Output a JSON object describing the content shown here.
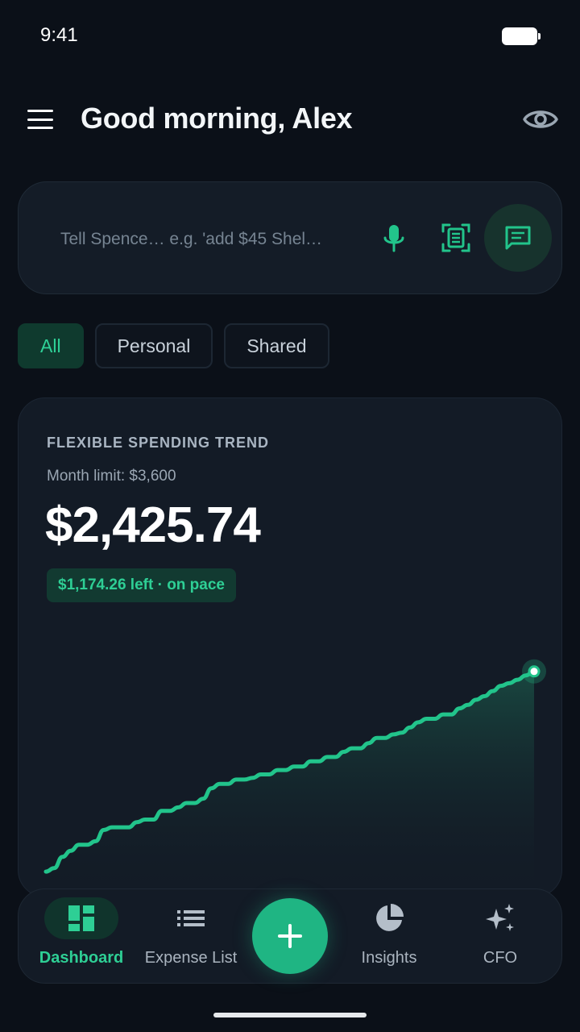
{
  "status_bar": {
    "time": "9:41"
  },
  "header": {
    "greeting": "Good morning, Alex"
  },
  "input": {
    "placeholder": "Tell Spence… e.g. 'add $45 Shel…"
  },
  "filters": [
    {
      "label": "All",
      "active": true
    },
    {
      "label": "Personal",
      "active": false
    },
    {
      "label": "Shared",
      "active": false
    }
  ],
  "card": {
    "title": "FLEXIBLE SPENDING TREND",
    "subtitle": "Month limit: $3,600",
    "amount": "$2,425.74",
    "pace": "$1,174.26 left · on pace"
  },
  "chart_data": {
    "type": "area",
    "title": "FLEXIBLE SPENDING TREND",
    "y_unit": "USD",
    "series": [
      {
        "values": [
          120,
          160,
          290,
          360,
          430,
          430,
          470,
          600,
          630,
          630,
          630,
          690,
          720,
          720,
          820,
          820,
          860,
          910,
          910,
          960,
          1080,
          1130,
          1130,
          1180,
          1180,
          1200,
          1240,
          1240,
          1290,
          1290,
          1330,
          1330,
          1390,
          1390,
          1440,
          1440,
          1500,
          1540,
          1540,
          1600,
          1660,
          1660,
          1700,
          1720,
          1780,
          1840,
          1880,
          1880,
          1930,
          1930,
          2000,
          2040,
          2100,
          2140,
          2200,
          2260,
          2290,
          2330,
          2380,
          2425.74
        ]
      }
    ],
    "ylim": [
      0,
      2600
    ],
    "grid": false,
    "colors": {
      "line": "#22c48b",
      "fill_top": "#1d6b55",
      "fill_bottom": "#131b26"
    }
  },
  "nav": {
    "items": [
      {
        "label": "Dashboard",
        "icon": "dashboard-icon",
        "active": true
      },
      {
        "label": "Expense List",
        "icon": "list-icon",
        "active": false
      },
      {
        "label": "Insights",
        "icon": "pie-chart-icon",
        "active": false
      },
      {
        "label": "CFO",
        "icon": "sparkle-icon",
        "active": false
      }
    ],
    "fab_icon": "plus-icon"
  },
  "colors": {
    "accent": "#2ecf95",
    "background": "#0b1018",
    "card": "#131b26"
  }
}
